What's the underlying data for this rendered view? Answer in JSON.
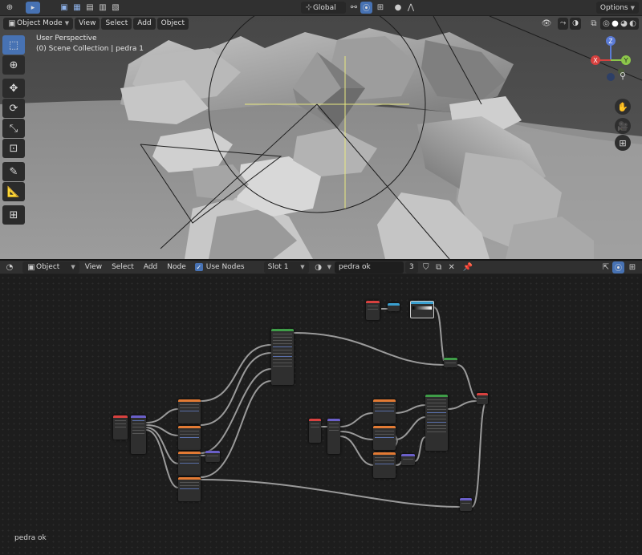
{
  "topbar": {
    "orientation": "Global",
    "options_label": "Options"
  },
  "viewport_header": {
    "mode": "Object Mode",
    "menus": [
      "View",
      "Select",
      "Add",
      "Object"
    ]
  },
  "viewport": {
    "perspective": "User Perspective",
    "collection": "(0) Scene Collection | pedra 1",
    "gizmo": {
      "x": "X",
      "y": "Y",
      "z": "Z"
    }
  },
  "node_header": {
    "type": "Object",
    "menus": [
      "View",
      "Select",
      "Add",
      "Node"
    ],
    "use_nodes_label": "Use Nodes",
    "slot": "Slot 1",
    "material_name": "pedra ok",
    "user_count": "3"
  },
  "node_editor": {
    "footer_label": "pedra ok"
  },
  "colors": {
    "accent": "#4772b3",
    "node_input": "#d8413f",
    "node_texture": "#e27a34",
    "node_vector": "#6a5fc8",
    "node_shader": "#3f9d48",
    "node_converter": "#3aa0d0"
  }
}
